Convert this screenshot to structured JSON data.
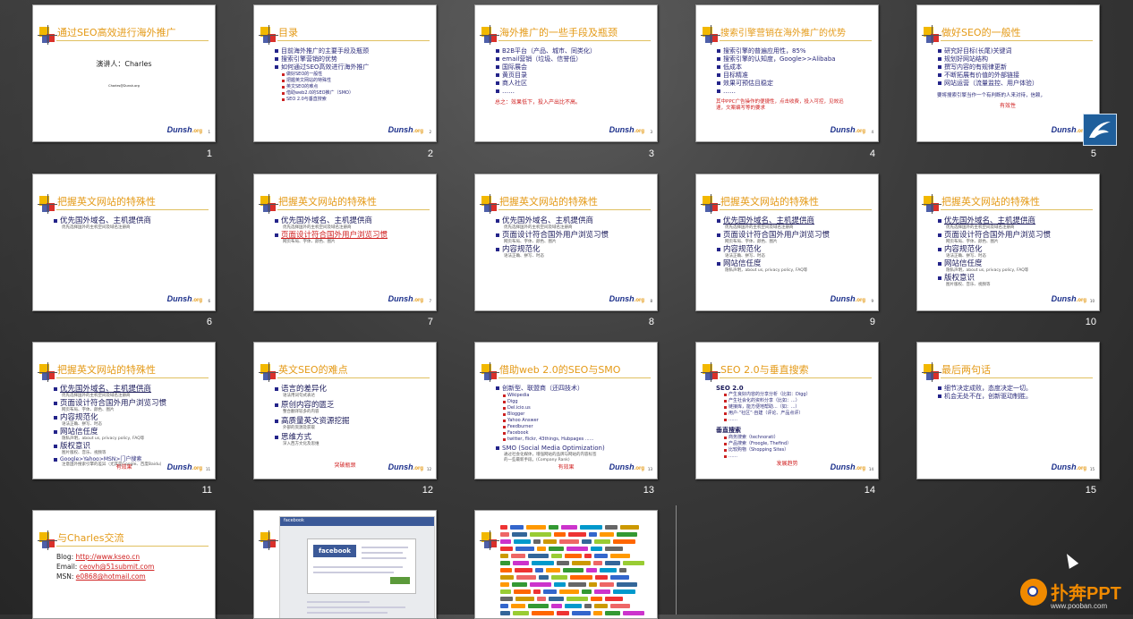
{
  "slides": [
    {
      "num": "1",
      "title": "通过SEO高效进行海外推广",
      "speaker": "演讲人：Charles",
      "sub": "Charles@Dunsh.org",
      "logo": "Dunsh",
      "pg": "1"
    },
    {
      "num": "2",
      "title": "目录",
      "bullets": [
        "目前海外推广的主要手段及瓶颈",
        "搜索引擎营销的优势",
        "如何通过SEO高效进行海外推广"
      ],
      "subs": [
        "做好SEO的一般性",
        "把握英文网站的特殊性",
        "英文SEO的难点",
        "借助web2.0的SEO推广（SMO）",
        "SEO 2.0与垂直搜索"
      ],
      "logo": "Dunsh",
      "pg": "2"
    },
    {
      "num": "3",
      "title": "海外推广的一些手段及瓶颈",
      "bullets": [
        "B2B平台（产品、城市、同类化）",
        "email营销（垃圾、信誉低）",
        "国际展会",
        "黄页目录",
        "商人社区",
        "……"
      ],
      "note": "总之：效果低下，投入产出比不高。",
      "logo": "Dunsh",
      "pg": "3"
    },
    {
      "num": "4",
      "title": "搜索引擎营销在海外推广的优势",
      "bullets": [
        "搜索引擎的普遍应用性，85%",
        "搜索引擎的认知度，Google>>Alibaba",
        "低成本",
        "目标精准",
        "效果可预估且稳定",
        "……"
      ],
      "note": "其中PPC广告操作的便捷性，点击收费，投入可控，见效迅速，文案编写等的要求",
      "logo": "Dunsh",
      "pg": "4"
    },
    {
      "num": "5",
      "title": "做好SEO的一般性",
      "bullets": [
        "研究好目标(长尾)关键词",
        "规划好网站结构",
        "撰写内容的有规律更新",
        "不断拓展有价值的外部链接",
        "网站运营（流量监控、用户体验）"
      ],
      "note1": "要将搜索引擎当作一个有判断的人来对待，信赖，",
      "note2": "有效性",
      "logo": "Dunsh",
      "pg": "5"
    },
    {
      "num": "6",
      "title": "把握英文网站的特殊性",
      "b": [
        {
          "t": "优先国外域名、主机提供商",
          "s": "优先选择国外的主机空间及域名注册商"
        }
      ],
      "logo": "Dunsh",
      "pg": "6"
    },
    {
      "num": "7",
      "title": "把握英文网站的特殊性",
      "b": [
        {
          "t": "优先国外域名、主机提供商",
          "s": "优先选择国外的主机空间及域名注册商"
        },
        {
          "t": "页面设计符合国外用户浏览习惯",
          "s": "网页布局、字体、颜色、图片"
        }
      ],
      "logo": "Dunsh",
      "pg": "7"
    },
    {
      "num": "8",
      "title": "把握英文网站的特殊性",
      "b": [
        {
          "t": "优先国外域名、主机提供商",
          "s": "优先选择国外的主机空间及域名注册商"
        },
        {
          "t": "页面设计符合国外用户浏览习惯",
          "s": "网页布局、字体、颜色、图片"
        },
        {
          "t": "内容规范化",
          "s": "语法正确、拼写、时态"
        }
      ],
      "logo": "Dunsh",
      "pg": "8"
    },
    {
      "num": "9",
      "title": "把握英文网站的特殊性",
      "b": [
        {
          "t": "优先国外域名、主机提供商",
          "s": "优先选择国外的主机空间及域名注册商"
        },
        {
          "t": "页面设计符合国外用户浏览习惯",
          "s": "网页布局、字体、颜色、图片"
        },
        {
          "t": "内容规范化",
          "s": "语法正确、拼写、时态"
        },
        {
          "t": "网站信任度",
          "s": "隐私声明，about us, privacy policy, FAQ等"
        }
      ],
      "logo": "Dunsh",
      "pg": "9"
    },
    {
      "num": "10",
      "title": "把握英文网站的特殊性",
      "b": [
        {
          "t": "优先国外域名、主机提供商",
          "s": "优先选择国外的主机空间及域名注册商"
        },
        {
          "t": "页面设计符合国外用户浏览习惯",
          "s": "网页布局、字体、颜色、图片"
        },
        {
          "t": "内容规范化",
          "s": "语法正确、拼写、时态"
        },
        {
          "t": "网站信任度",
          "s": "隐私声明，about us, privacy policy, FAQ等"
        },
        {
          "t": "版权意识",
          "s": "图片版权、音乐、视频等"
        }
      ],
      "logo": "Dunsh",
      "pg": "10"
    },
    {
      "num": "11",
      "title": "把握英文网站的特殊性",
      "b": [
        {
          "t": "优先国外域名、主机提供商",
          "s": "优先选择国外的主机空间及域名注册商"
        },
        {
          "t": "页面设计符合国外用户浏览习惯",
          "s": "网页布局、字体、颜色、图片"
        },
        {
          "t": "内容规范化",
          "s": "语法正确、拼写、时态"
        },
        {
          "t": "网站信任度",
          "s": "隐私声明，about us, privacy policy, FAQ等"
        },
        {
          "t": "版权意识",
          "s": "图片版权、音乐、视频等"
        }
      ],
      "extra": "Google>Yahoo>MSN>门户搜索",
      "extra2": "注意国外搜索引擎的差异（尤其是Google、百度Baidu）",
      "note": "有效果",
      "logo": "Dunsh",
      "pg": "11"
    },
    {
      "num": "12",
      "title": "英文SEO的难点",
      "b": [
        {
          "t": "语言的差异化",
          "s": "语法用词句式表达"
        },
        {
          "t": "原创内容的匮乏",
          "s": "整合翻译较多的内容"
        },
        {
          "t": "高质量英文资源挖掘",
          "s": "外部的资源及获取"
        },
        {
          "t": "思维方式",
          "s": "深入西方文化及思维"
        }
      ],
      "note": "突破瓶颈",
      "logo": "Dunsh",
      "pg": "12"
    },
    {
      "num": "13",
      "title": "借助web 2.0的SEO与SMO",
      "bullets": [
        "创新型、联盟商（还四技术）"
      ],
      "subs": [
        "Wikipedia",
        "Digg",
        "Del.icio.us",
        "Blogger",
        "Yahoo Answer",
        "Feedburner",
        "Facebook",
        "twitter, flickr, 43things, Hubpages ......"
      ],
      "bullet2": "SMO (Social Media Optimization)",
      "sub2a": "通过社会化媒体，增强网站的品牌与网站的内容标签",
      "sub2b": "的一些最新手段。(Company Rank)",
      "note": "有效果",
      "logo": "Dunsh",
      "pg": "13"
    },
    {
      "num": "14",
      "title": "SEO 2.0与垂直搜索",
      "h1": "SEO 2.0",
      "l1": [
        "产生良好内容的分享分析（比如：Digg）",
        "产生社会化的资料分享（比如：...）",
        "链接库，能方便地帮助...（如：...）",
        "用户·“社区”·自建（评论、产品点评）",
        "……"
      ],
      "h2": "垂直搜索",
      "l2": [
        "商务搜索（technorati）",
        "产品搜索（Froogle, Thefind）",
        "比较购物（Shopping Sites）",
        "……"
      ],
      "note": "发展趋势",
      "logo": "Dunsh",
      "pg": "14"
    },
    {
      "num": "15",
      "title": "最后两句话",
      "bullets": [
        "细节决定成败，态度决定一切。",
        "机会无处不在，创新驱动制胜。"
      ],
      "logo": "Dunsh",
      "pg": "15"
    },
    {
      "num": "",
      "title": "与Charles交流",
      "blog_label": "Blog: ",
      "blog": "http://www.kseo.cn",
      "email_label": "Email: ",
      "email": "ceovh@51submit.com",
      "msn_label": "MSN: ",
      "msn": "e0868@hotmail.com"
    },
    {
      "num": "",
      "fb_top": "facebook",
      "fb_logo": "facebook"
    },
    {
      "num": ""
    }
  ],
  "brand": {
    "name": "扑奔PPT",
    "url": "www.pooban.com"
  },
  "colors": {
    "title": "#e49a17",
    "bullet": "#24248a",
    "accent_red": "#d02020",
    "brand_orange": "#f08a00"
  }
}
